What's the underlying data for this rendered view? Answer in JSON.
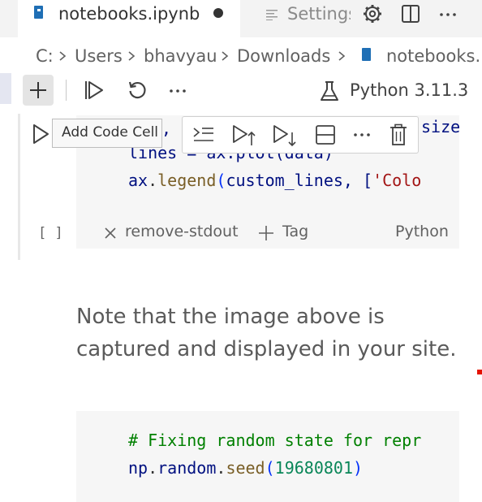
{
  "tabs": [
    {
      "label": "notebooks.ipynb",
      "active": true,
      "modified": true
    },
    {
      "label": "Settings",
      "active": false
    }
  ],
  "tab_actions": [
    "gear-icon",
    "split-editor-icon",
    "more-icon"
  ],
  "breadcrumb": {
    "items": [
      "C:",
      "Users",
      "bhavyau",
      "Downloads",
      "notebooks."
    ]
  },
  "toolbar": {
    "kernel": "Python 3.11.3",
    "buttons": [
      "add-code-cell",
      "run-all",
      "restart",
      "more"
    ]
  },
  "tooltip": {
    "text": "Add Code Cell"
  },
  "cell1": {
    "line0_fragment": ",",
    "line0_tail": "size",
    "line1": "lines = ax.plot(data)",
    "line2_obj": "ax",
    "line2_method": "legend",
    "line2_args": "custom_lines, [",
    "line2_str": "'Colo",
    "exec_count": "[ ]",
    "tag_remove": "remove-stdout",
    "tag_add": "Tag",
    "language": "Python"
  },
  "markdown": {
    "text": "Note that the image above is captured and displayed in your site."
  },
  "cell2": {
    "comment": "# Fixing random state for repr",
    "line2_mod": "np",
    "line2_attr": "random",
    "line2_fn": "seed",
    "line2_arg": "19680801"
  },
  "colors": {
    "keyword_blue": "#001080",
    "method_yellow": "#795e26",
    "string_red": "#a31515",
    "number_green": "#098658",
    "comment_green": "#008000",
    "tab_bar": "#f3f3f3",
    "notebook_icon": "#1f6fb5"
  }
}
